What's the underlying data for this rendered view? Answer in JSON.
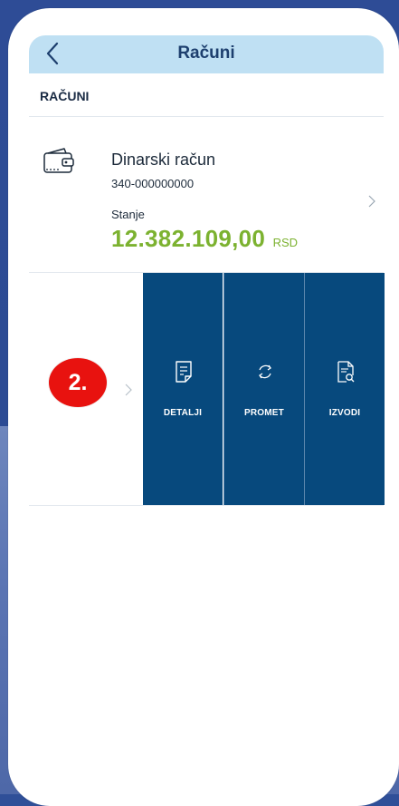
{
  "header": {
    "title": "Računi"
  },
  "section": {
    "label": "RAČUNI"
  },
  "account": {
    "name": "Dinarski račun",
    "number": "340-000000000",
    "balance_label": "Stanje",
    "balance_amount": "12.382.109,00",
    "balance_currency": "RSD"
  },
  "actions": [
    {
      "label": "DETALJI",
      "icon": "document-icon"
    },
    {
      "label": "PROMET",
      "icon": "refresh-icon"
    },
    {
      "label": "IZVODI",
      "icon": "statement-search-icon"
    }
  ],
  "annotation": {
    "step": "2."
  },
  "colors": {
    "header_bg": "#bfe0f3",
    "balance_green": "#7cb230",
    "action_bg": "#07497d",
    "badge_red": "#e8120f"
  }
}
